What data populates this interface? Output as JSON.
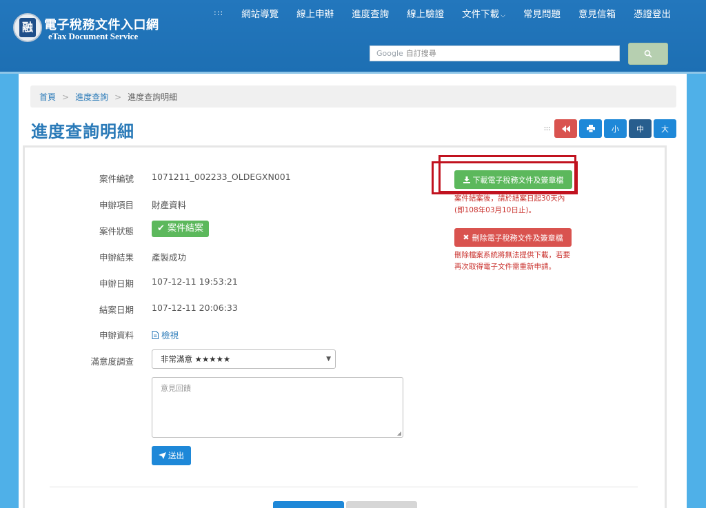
{
  "header": {
    "logo_title": "電子稅務文件入口網",
    "logo_subtitle": "eTax Document Service",
    "logo_glyph": "融",
    "nav": [
      {
        "label": ":::"
      },
      {
        "label": "網站導覽"
      },
      {
        "label": "線上申辦"
      },
      {
        "label": "進度查詢"
      },
      {
        "label": "線上驗證"
      },
      {
        "label": "文件下載"
      },
      {
        "label": "常見問題"
      },
      {
        "label": "意見信箱"
      },
      {
        "label": "憑證登出"
      }
    ],
    "search_brand": "Google",
    "search_placeholder": "自訂搜尋",
    "search_icon": "search-icon"
  },
  "breadcrumb": {
    "home": "首頁",
    "parent": "進度查詢",
    "current": "進度查詢明細"
  },
  "page_title": "進度查詢明細",
  "tools": {
    "grip": ":::",
    "back_icon": "rewind-icon",
    "print_icon": "print-icon",
    "small": "小",
    "medium": "中",
    "large": "大"
  },
  "details": {
    "case_no_label": "案件編號",
    "case_no": "1071211_002233_OLDEGXN001",
    "item_label": "申辦項目",
    "item": "財產資料",
    "status_label": "案件狀態",
    "status": "案件結案",
    "result_label": "申辦結果",
    "result": "產製成功",
    "apply_date_label": "申辦日期",
    "apply_date": "107-12-11 19:53:21",
    "close_date_label": "結案日期",
    "close_date": "107-12-11 20:06:33",
    "data_label": "申辦資料",
    "view": "檢視",
    "survey_label": "滿意度調查",
    "survey_value": "非常滿意 ★★★★★",
    "feedback_placeholder": "意見回饋",
    "send": "送出"
  },
  "actions": {
    "download": "下載電子稅務文件及簽章檔",
    "download_note": "案件結案後，請於結案日起30天內(即108年03月10日止)。",
    "delete": "刪除電子稅務文件及簽章檔",
    "delete_note": "刪除檔案系統將無法提供下載，若要再次取得電子文件需重新申請。"
  },
  "colors": {
    "header_blue": "#1d6fb3",
    "accent_blue": "#2a7ab8",
    "success_green": "#5cb85c",
    "danger_red": "#d9534f",
    "annotation_red": "#c1121f"
  }
}
